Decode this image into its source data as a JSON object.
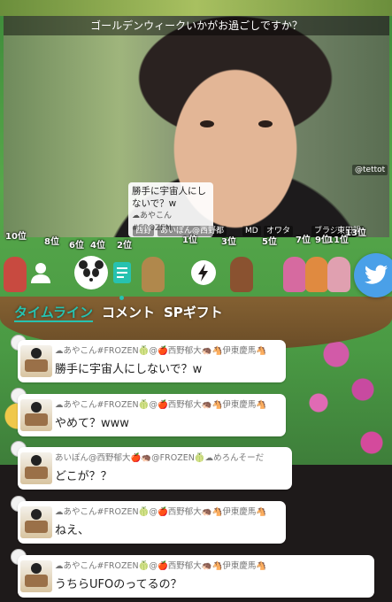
{
  "stream": {
    "banner": "ゴールデンウィークいかがお過ごしですか？",
    "video_comment": {
      "text": "勝手に宇宙人にしないで？w",
      "user": "☁あやこん #FROZEN"
    },
    "tags": [
      "西野",
      "あいぽん@西野都",
      "MD",
      "オワタ",
      "ブラジ",
      "東田陽",
      "@tettot"
    ]
  },
  "ranks": [
    "10位",
    "8位",
    "6位",
    "4位",
    "2位",
    "1位",
    "3位",
    "5位",
    "7位",
    "9位",
    "11位",
    "13位"
  ],
  "menu": {
    "tabs": [
      "タイムライン",
      "コメント",
      "SPギフト"
    ]
  },
  "timeline": [
    {
      "user": "☁あやこん#FROZEN🍈@🍎西野郁大🦔🐴伊東慶馬🐴",
      "text": "勝手に宇宙人にしないで？w"
    },
    {
      "user": "☁あやこん#FROZEN🍈@🍎西野郁大🦔🐴伊東慶馬🐴",
      "text": "やめて？www"
    },
    {
      "user": "あいぽん@西野郁大🍎🦔@FROZEN🍈☁めろんそーだ",
      "text": "どこが？？"
    },
    {
      "user": "☁あやこん#FROZEN🍈@🍎西野郁大🦔🐴伊東慶馬🐴",
      "text": "ねえ、"
    },
    {
      "user": "☁あやこん#FROZEN🍈@🍎西野郁大🦔🐴伊東慶馬🐴",
      "text": "うちらUFOのってるの？"
    }
  ]
}
